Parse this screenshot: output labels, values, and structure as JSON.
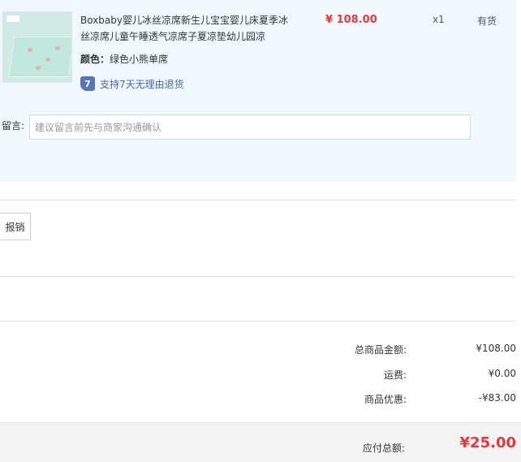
{
  "item": {
    "image_alt": "婴儿冰丝凉席产品图",
    "title": "Boxbaby婴儿冰丝凉席新生儿宝宝婴儿床夏季冰丝凉席儿童午睡透气凉席子夏凉垫幼儿园凉",
    "price": "¥ 108.00",
    "quantity": "x1",
    "stock": "有货",
    "color_key": "颜色：",
    "color_value": "绿色小熊单席",
    "return_icon_text": "7",
    "return_policy": "支持7天无理由退货"
  },
  "message": {
    "label": "留言:",
    "placeholder": "建议留言前先与商家沟通确认"
  },
  "invoice": {
    "button_label": "报销"
  },
  "summary": {
    "rows": [
      {
        "label": "总商品金额:",
        "value": "¥108.00"
      },
      {
        "label": "运费:",
        "value": "¥0.00"
      },
      {
        "label": "商品优惠:",
        "value": "-¥83.00"
      }
    ],
    "total_label": "应付总额:",
    "total_value": "¥25.00"
  },
  "colors": {
    "accent_red": "#e4393c",
    "panel_bg": "#f2f9fe",
    "link_blue": "#4466aa",
    "return_icon_bg": "#5b74b9"
  }
}
